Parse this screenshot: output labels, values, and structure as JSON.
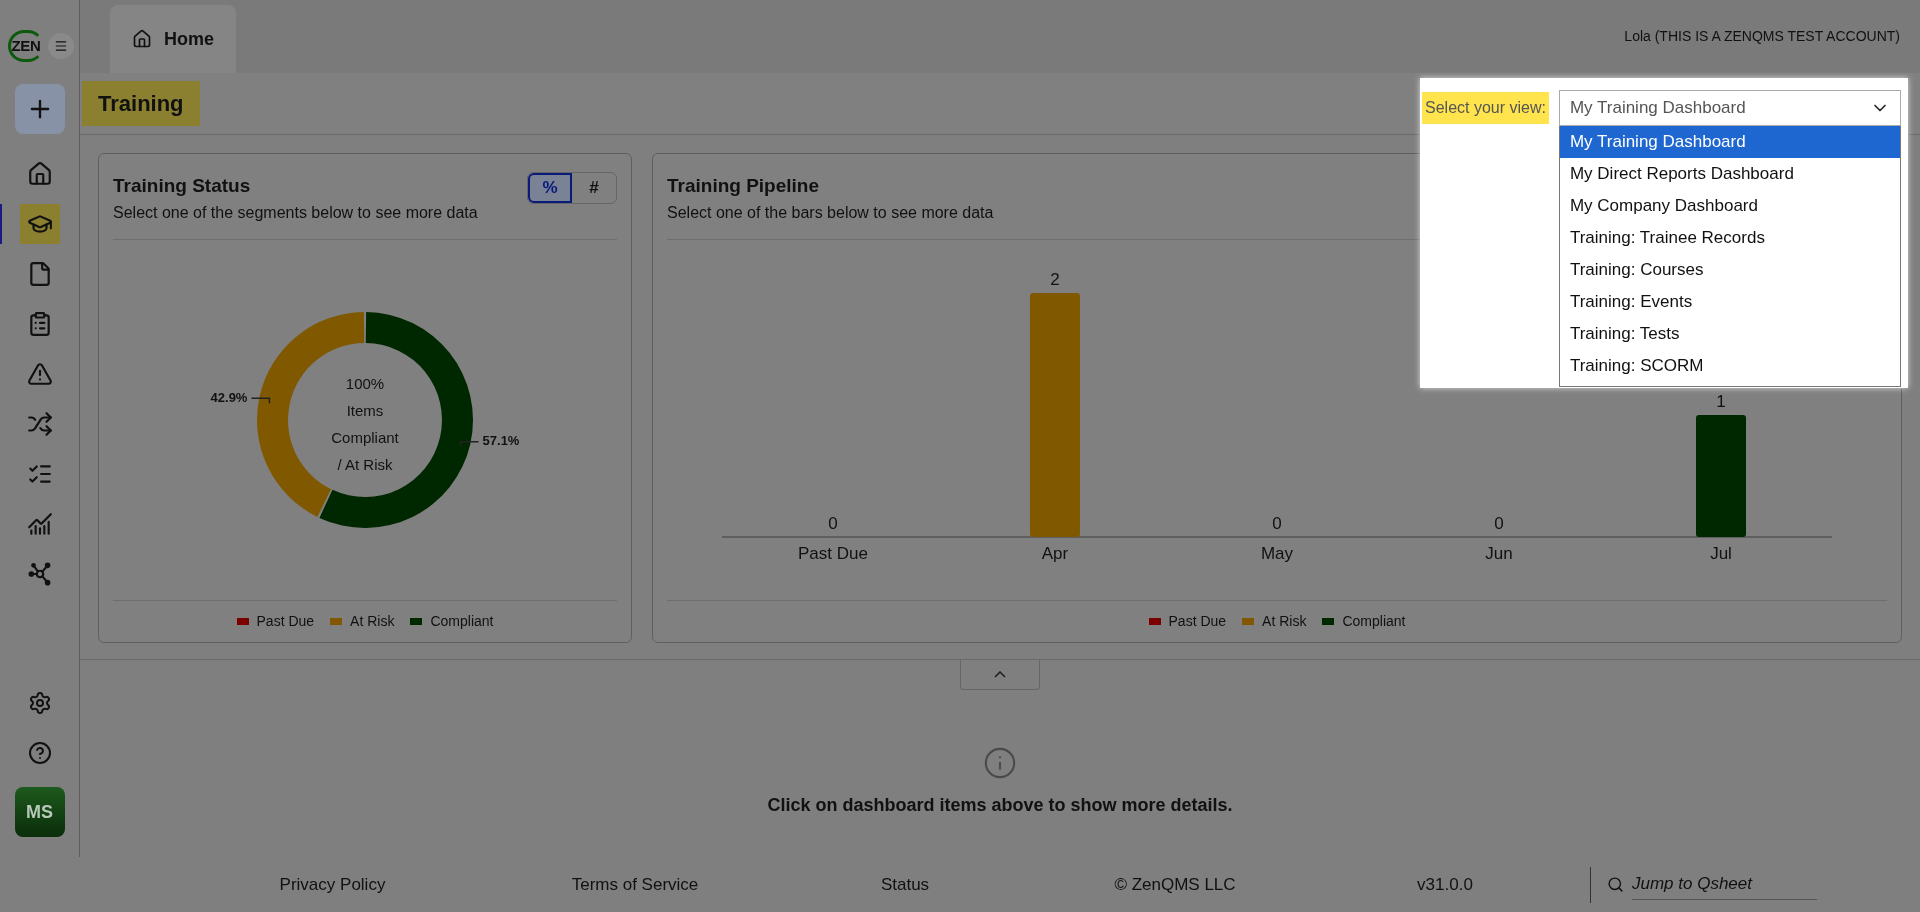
{
  "logo": "ZEN",
  "nav": [
    {
      "selected": false
    },
    {
      "selected": true
    },
    {
      "selected": false
    },
    {
      "selected": false
    },
    {
      "selected": false
    },
    {
      "selected": false
    },
    {
      "selected": false
    },
    {
      "selected": false
    },
    {
      "selected": false
    }
  ],
  "avatar": "MS",
  "tabs": [
    {
      "label": "Home",
      "selected": true
    }
  ],
  "user": "Lola (THIS IS A ZENQMS TEST ACCOUNT)",
  "page_title": "Training",
  "view_selector": {
    "label": "Select your view:",
    "value": "My Training Dashboard",
    "expanded": true,
    "options": [
      {
        "label": "My Training Dashboard",
        "selected": true
      },
      {
        "label": "My Direct Reports Dashboard",
        "selected": false
      },
      {
        "label": "My Company Dashboard",
        "selected": false
      },
      {
        "label": "Training: Trainee Records",
        "selected": false
      },
      {
        "label": "Training: Courses",
        "selected": false
      },
      {
        "label": "Training: Events",
        "selected": false
      },
      {
        "label": "Training: Tests",
        "selected": false
      },
      {
        "label": "Training: SCORM",
        "selected": false
      }
    ]
  },
  "status_card": {
    "title": "Training Status",
    "subtitle": "Select one of the segments below to see more data",
    "toggle": [
      {
        "label": "%",
        "selected": true
      },
      {
        "label": "#",
        "selected": false
      }
    ],
    "center_text": [
      "100%",
      "Items",
      "Compliant",
      "/ At Risk"
    ],
    "chart_data": {
      "type": "donut",
      "categories": [
        "Past Due",
        "At Risk",
        "Compliant"
      ],
      "values": [
        0,
        42.9,
        57.1
      ],
      "colors": [
        "#7a0000",
        "#805800",
        "#002800"
      ],
      "value_labels": [
        null,
        "42.9%",
        "57.1%"
      ]
    }
  },
  "pipeline_card": {
    "title": "Training Pipeline",
    "subtitle": "Select one of the bars below to see more data",
    "chart_data": {
      "type": "bar",
      "data_labels": true,
      "categories": [
        "Past Due",
        "Apr",
        "May",
        "Jun",
        "Jul"
      ],
      "values": [
        0,
        2,
        0,
        0,
        1
      ],
      "colors": [
        null,
        "#805800",
        null,
        null,
        "#002800"
      ]
    },
    "legend": [
      {
        "name": "Past Due",
        "color": "#7a0000"
      },
      {
        "name": "At Risk",
        "color": "#805800"
      },
      {
        "name": "Compliant",
        "color": "#002800"
      }
    ]
  },
  "details_hint": "Click on dashboard items above to show more details.",
  "footer": {
    "links": [
      "Privacy Policy",
      "Terms of Service",
      "Status",
      "© ZenQMS LLC",
      "v31.0.0"
    ],
    "search_placeholder": "Jump to Qsheet"
  }
}
